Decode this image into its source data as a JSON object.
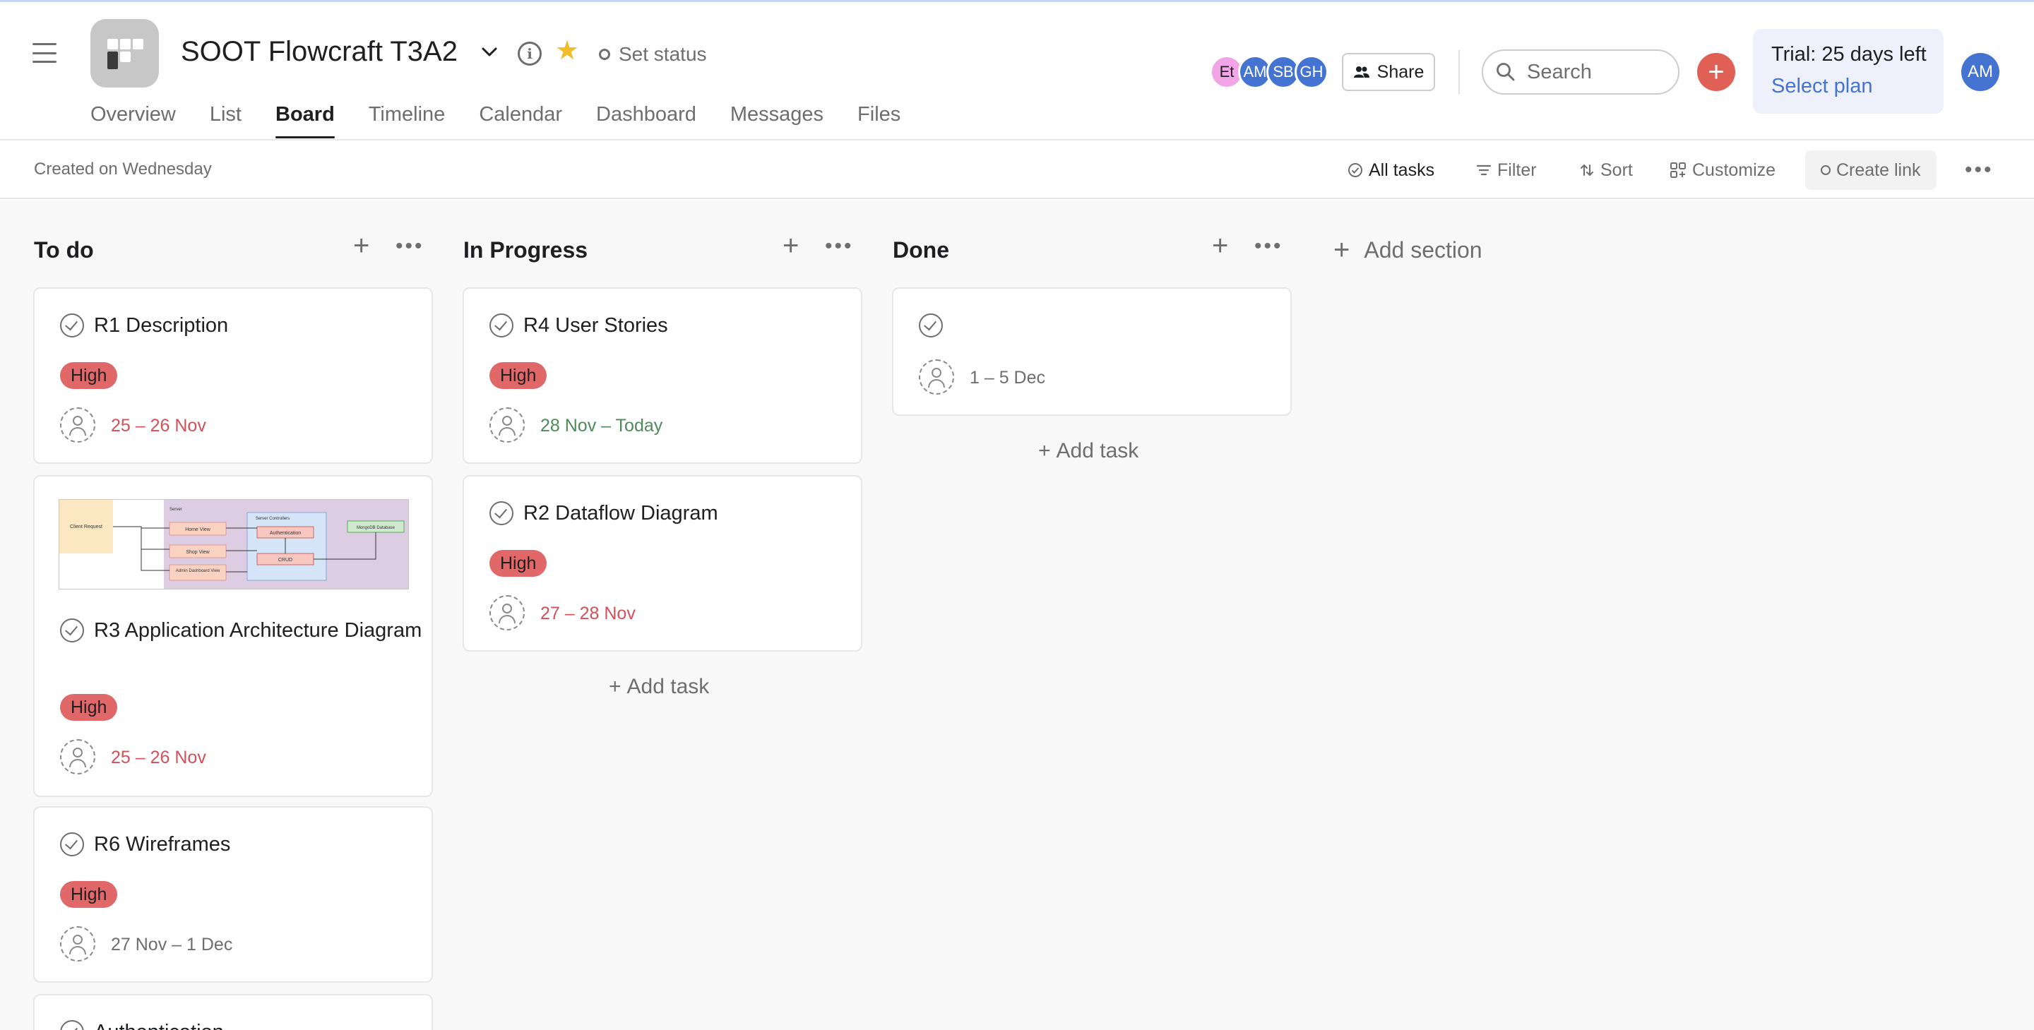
{
  "project": {
    "title": "SOOT Flowcraft T3A2",
    "set_status": "Set status"
  },
  "header": {
    "avatars": [
      {
        "initials": "Et",
        "color": "#f1a5e6"
      },
      {
        "initials": "AM",
        "color": "#4573d2"
      },
      {
        "initials": "SB",
        "color": "#4573d2"
      },
      {
        "initials": "GH",
        "color": "#4573d2"
      }
    ],
    "share_label": "Share",
    "search_placeholder": "Search",
    "trial_text": "Trial: 25 days left",
    "select_plan": "Select plan",
    "user_initials": "AM"
  },
  "tabs": [
    "Overview",
    "List",
    "Board",
    "Timeline",
    "Calendar",
    "Dashboard",
    "Messages",
    "Files"
  ],
  "active_tab": "Board",
  "toolbar": {
    "created": "Created on Wednesday",
    "all_tasks": "All tasks",
    "filter": "Filter",
    "sort": "Sort",
    "customize": "Customize",
    "create_link": "Create link"
  },
  "board": {
    "add_section": "Add section",
    "add_task": "Add task",
    "columns": [
      {
        "name": "To do",
        "cards": [
          {
            "title": "R1 Description",
            "priority": "High",
            "date": "25 – 26 Nov"
          },
          {
            "title": "R3 Application Architecture Diagram",
            "priority": "High",
            "date": "25 – 26 Nov"
          },
          {
            "title": "R6 Wireframes",
            "priority": "High",
            "date": "27 Nov – 1 Dec"
          },
          {
            "title": "Authentication"
          }
        ]
      },
      {
        "name": "In Progress",
        "cards": [
          {
            "title": "R4 User Stories",
            "priority": "High",
            "date": "28 Nov – Today"
          },
          {
            "title": "R2 Dataflow Diagram",
            "priority": "High",
            "date": "27 – 28 Nov"
          }
        ]
      },
      {
        "name": "Done",
        "cards": [
          {
            "title": "",
            "date": "1 – 5 Dec"
          }
        ]
      }
    ]
  },
  "diagram_thumbnail": {
    "labels": [
      "Client Request",
      "Server",
      "Home View",
      "Shop View",
      "Admin Dashboard View",
      "Server Controllers",
      "Authentication",
      "CRUD",
      "MongoDB Database"
    ]
  },
  "colors": {
    "priority_high": "#e06868",
    "date_overdue": "#d1525a",
    "date_today": "#4f8a5b",
    "accent": "#4573d2",
    "add_button": "#e06055"
  }
}
